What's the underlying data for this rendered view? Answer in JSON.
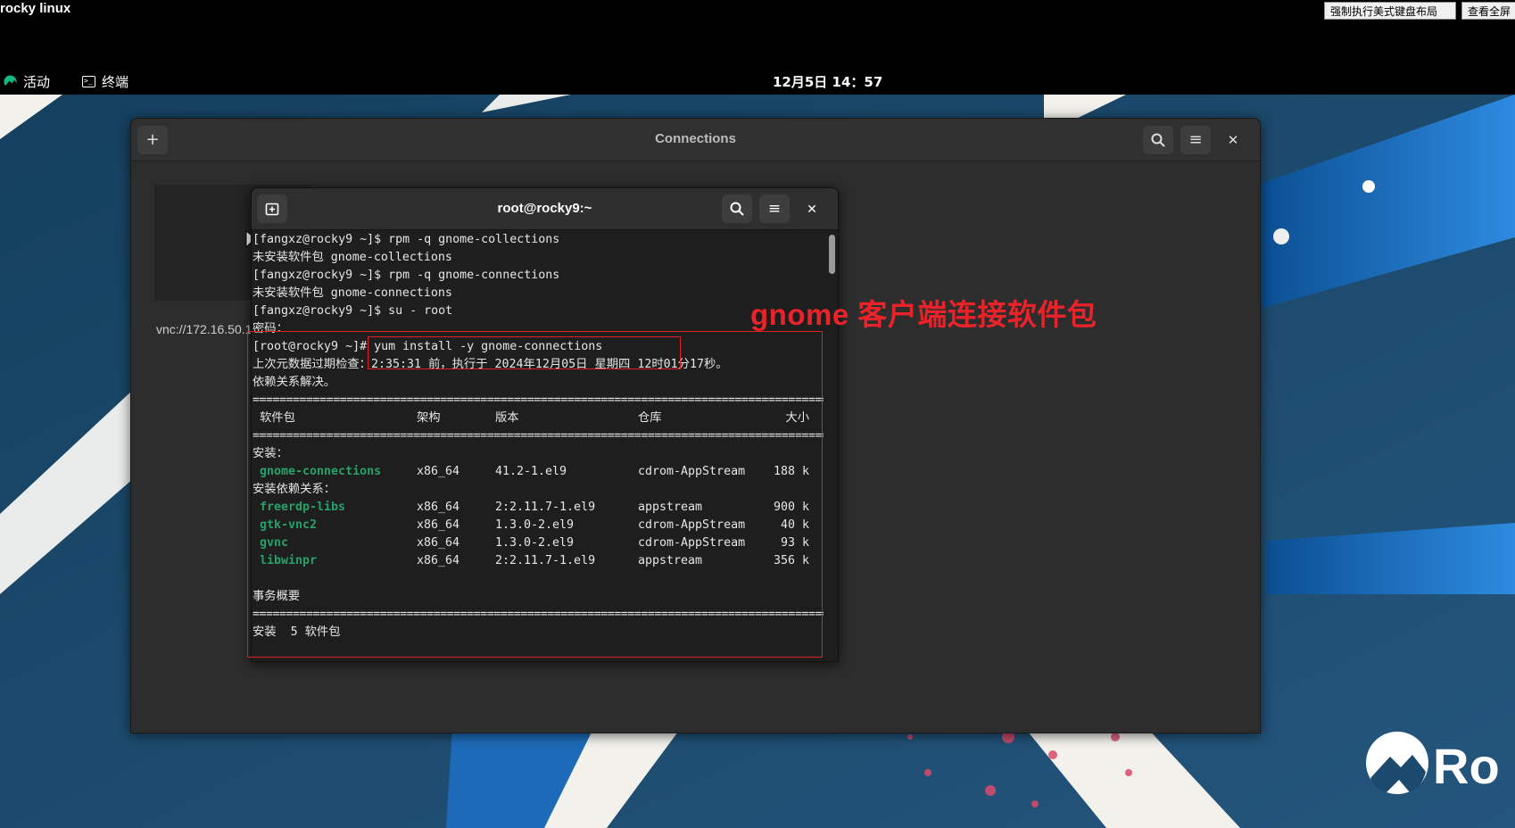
{
  "topbar": {
    "app_title": "rocky linux",
    "force_us_keyboard": "强制执行美式键盘布局",
    "fullscreen": "查看全屏"
  },
  "panel": {
    "activities": "活动",
    "terminal_app": "终端",
    "clock": "12月5日  14：57"
  },
  "connections": {
    "title": "Connections",
    "vnc_address": "vnc://172.16.50.1"
  },
  "terminal": {
    "title": "root@rocky9:~",
    "lines": {
      "l1": "[fangxz@rocky9 ~]$ rpm -q gnome-collections",
      "l2": "未安装软件包 gnome-collections",
      "l3": "[fangxz@rocky9 ~]$ rpm -q gnome-connections",
      "l4": "未安装软件包 gnome-connections",
      "l5": "[fangxz@rocky9 ~]$ su - root",
      "l6": "密码：",
      "l7_prompt": "[root@rocky9 ~]# ",
      "l7_cmd": "yum install -y gnome-connections",
      "l8": "上次元数据过期检查：2:35:31 前，执行于 2024年12月05日 星期四 12时01分17秒。",
      "l9": "依赖关系解决。",
      "sep": "================================================================================================",
      "installing": "安装：",
      "installing_deps": "安装依赖关系：",
      "summary": "事务概要",
      "install_count": "安装  5 软件包"
    },
    "columns": {
      "package": "软件包",
      "arch": "架构",
      "version": "版本",
      "repo": "仓库",
      "size": "大小"
    },
    "packages": [
      {
        "name": "gnome-connections",
        "arch": "x86_64",
        "version": "41.2-1.el9",
        "repo": "cdrom-AppStream",
        "size": "188 k"
      }
    ],
    "dependencies": [
      {
        "name": "freerdp-libs",
        "arch": "x86_64",
        "version": "2:2.11.7-1.el9",
        "repo": "appstream",
        "size": "900 k"
      },
      {
        "name": "gtk-vnc2",
        "arch": "x86_64",
        "version": "1.3.0-2.el9",
        "repo": "cdrom-AppStream",
        "size": "40 k"
      },
      {
        "name": "gvnc",
        "arch": "x86_64",
        "version": "1.3.0-2.el9",
        "repo": "cdrom-AppStream",
        "size": "93 k"
      },
      {
        "name": "libwinpr",
        "arch": "x86_64",
        "version": "2:2.11.7-1.el9",
        "repo": "appstream",
        "size": "356 k"
      }
    ]
  },
  "annotation": {
    "text": "gnome 客户端连接软件包"
  },
  "colors": {
    "annotation_red": "#e8242a",
    "package_green": "#26a269",
    "wallpaper_blue": "#1c4a6e"
  }
}
